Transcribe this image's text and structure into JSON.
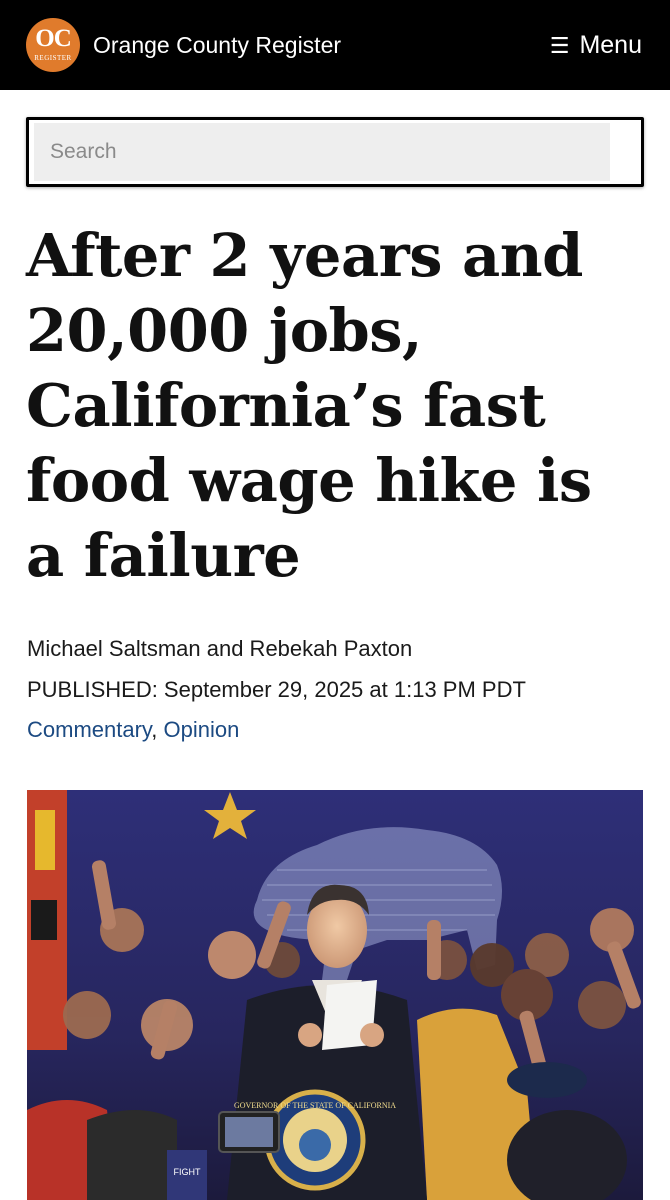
{
  "header": {
    "logo_text": "OC",
    "logo_subtext": "REGISTER",
    "site_name": "Orange County Register",
    "menu_icon": "☰",
    "menu_label": "Menu"
  },
  "search": {
    "placeholder": "Search"
  },
  "article": {
    "headline": "After 2 years and 20,000 jobs, California’s fast food wage hike is a failure",
    "byline": "Michael Saltsman and Rebekah Paxton",
    "published": "PUBLISHED: September 29, 2025 at 1:13 PM PDT",
    "categories": [
      "Commentary",
      "Opinion"
    ],
    "category_separator": ", "
  },
  "photo": {
    "seal_text": "GOVERNOR OF THE STATE OF CALIFORNIA",
    "sign_text": "FIGHT"
  },
  "colors": {
    "header_bg": "#000000",
    "logo_orange": "#e07b2c",
    "link_blue": "#1c4a82",
    "banner_blue": "#2b2a6e"
  }
}
